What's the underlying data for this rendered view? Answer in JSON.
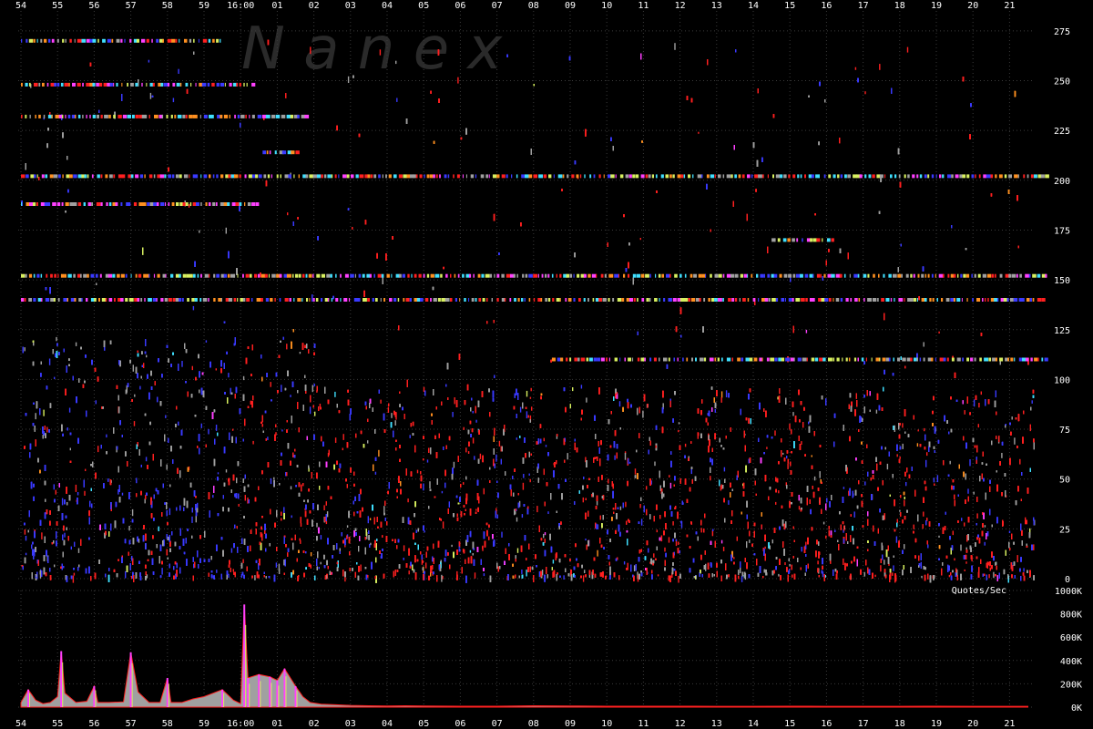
{
  "watermark": "N a n e x",
  "colors": {
    "background": "#000000",
    "gridline": "#3a3a3a",
    "text": "#ffffff",
    "quote_red": "#ff2020",
    "quote_blue": "#3a3aff",
    "quote_gray": "#a0a0a0",
    "quote_yellow": "#d8f060",
    "quote_magenta": "#ff40ff",
    "quote_cyan": "#40e0ff",
    "quote_orange": "#ff9020",
    "quote_white": "#ffffff"
  },
  "chart_data": [
    {
      "type": "scatter",
      "title": "",
      "xlabel": "",
      "ylabel": "",
      "x_tick_labels": [
        "54",
        "55",
        "56",
        "57",
        "58",
        "59",
        "16:00",
        "01",
        "02",
        "03",
        "04",
        "05",
        "06",
        "07",
        "08",
        "09",
        "10",
        "11",
        "12",
        "13",
        "14",
        "15",
        "16",
        "17",
        "18",
        "19",
        "20",
        "21"
      ],
      "y_ticks": [
        0,
        25,
        50,
        75,
        100,
        125,
        150,
        175,
        200,
        225,
        250,
        275
      ],
      "ylim": [
        0,
        285
      ],
      "grid": true,
      "series_colors": [
        "#3a3aff",
        "#ff2020",
        "#a0a0a0",
        "#d8f060",
        "#ff40ff",
        "#40e0ff",
        "#ff9020"
      ],
      "price_bands": [
        {
          "price": 270,
          "from": 0,
          "to": 5.5
        },
        {
          "price": 248,
          "from": 0,
          "to": 6.3
        },
        {
          "price": 232,
          "from": 0,
          "to": 7.8
        },
        {
          "price": 214,
          "from": 6.6,
          "to": 7.6
        },
        {
          "price": 202,
          "from": 0,
          "to": 28
        },
        {
          "price": 188,
          "from": 0,
          "to": 6.5
        },
        {
          "price": 170,
          "from": 20.5,
          "to": 22.2
        },
        {
          "price": 152,
          "from": 0,
          "to": 28
        },
        {
          "price": 140,
          "from": 0,
          "to": 28
        },
        {
          "price": 110,
          "from": 14.5,
          "to": 28
        }
      ]
    },
    {
      "type": "area",
      "title": "",
      "ylabel": "Quotes/Sec",
      "x_tick_labels": [
        "54",
        "55",
        "56",
        "57",
        "58",
        "59",
        "16:00",
        "01",
        "02",
        "03",
        "04",
        "05",
        "06",
        "07",
        "08",
        "09",
        "10",
        "11",
        "12",
        "13",
        "14",
        "15",
        "16",
        "17",
        "18",
        "19",
        "20",
        "21"
      ],
      "y_tick_labels": [
        "0K",
        "200K",
        "400K",
        "600K",
        "800K",
        "1000K"
      ],
      "y_ticks": [
        0,
        200,
        400,
        600,
        800,
        1000
      ],
      "ylim": [
        0,
        1000
      ],
      "series": [
        {
          "x": [
            0,
            0.2,
            0.4,
            0.6,
            0.8,
            1.0,
            1.1,
            1.2,
            1.5,
            1.8,
            2.0,
            2.1,
            2.4,
            2.8,
            3.0,
            3.2,
            3.5,
            3.8,
            4.0,
            4.1,
            4.4,
            4.7,
            5.0,
            5.5,
            5.8,
            6.0,
            6.1,
            6.2,
            6.5,
            6.8,
            7.0,
            7.2,
            7.5,
            7.7,
            7.9,
            8.2,
            8.6,
            9.0,
            9.5,
            10.0,
            10.5,
            11.0,
            12.0,
            13.0,
            14.0,
            15.0,
            16.0,
            17.0,
            18.0,
            19.0,
            20.0,
            21.0,
            22.0,
            23.0,
            24.0,
            25.0,
            26.0,
            27.0,
            27.5
          ],
          "values": [
            40,
            150,
            60,
            30,
            40,
            90,
            480,
            120,
            40,
            50,
            180,
            40,
            40,
            45,
            470,
            130,
            40,
            40,
            250,
            40,
            40,
            70,
            90,
            150,
            60,
            30,
            880,
            250,
            280,
            260,
            230,
            330,
            180,
            90,
            40,
            25,
            20,
            15,
            12,
            10,
            12,
            10,
            8,
            8,
            12,
            10,
            8,
            8,
            8,
            7,
            7,
            8,
            7,
            7,
            7,
            8,
            7,
            7,
            7
          ]
        }
      ]
    }
  ]
}
